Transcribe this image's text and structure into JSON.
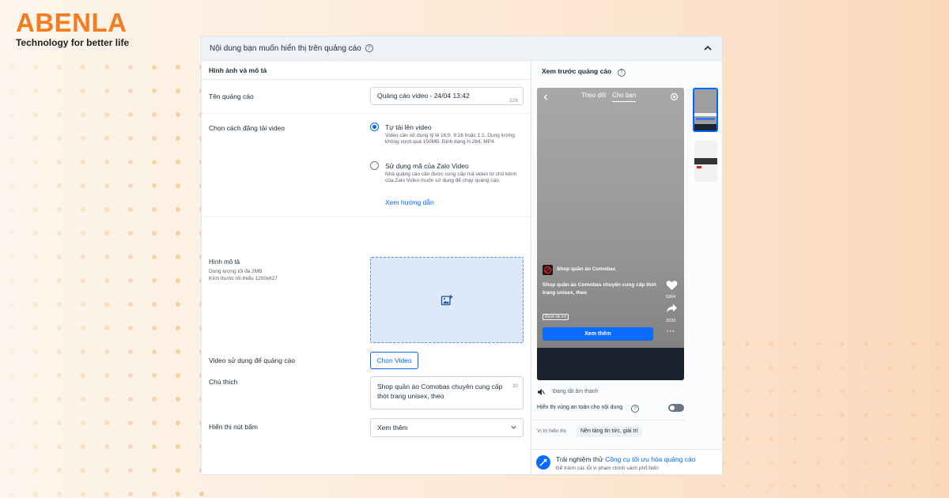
{
  "brand": {
    "name": "ABENLA",
    "tagline": "Technology for better life"
  },
  "panel": {
    "title": "Nội dung bạn muốn hiển thị trên quảng cáo"
  },
  "form": {
    "section_title": "Hình ảnh và mô tả",
    "ad_name": {
      "label": "Tên quảng cáo",
      "value": "Quảng cáo video - 24/04 13:42",
      "counter": "226"
    },
    "upload_method": {
      "label": "Chọn cách đăng tải video",
      "option1": {
        "title": "Tự tải lên video",
        "desc": "Video cần sử dụng tỷ lệ 16:9, 9:16 hoặc 1:1. Dung lượng không vượt quá 150MB. Định dạng H.264, MP4."
      },
      "option2": {
        "title": "Sử dụng mã của Zalo Video",
        "desc": "Nhà quảng cáo cần được cung cấp mã video từ chủ kênh của Zalo Video muốn sử dụng để chạy quảng cáo."
      },
      "guide_link": "Xem hướng dẫn"
    },
    "description_image": {
      "label": "Hình mô tả",
      "sub1": "Dung lượng tối đa 2MB",
      "sub2": "Kích thước tối thiểu 1200x627"
    },
    "video": {
      "label": "Video sử dụng để quảng cáo",
      "button": "Chọn Video"
    },
    "caption": {
      "label": "Chú thích",
      "value": "Shop quần áo Comobas chuyên cung cấp thời trang unisex, theo",
      "counter": "30"
    },
    "cta": {
      "label": "Hiển thị nút bấm",
      "value": "Xem thêm"
    }
  },
  "preview": {
    "title": "Xem trước quảng cáo",
    "tabs": [
      "Theo dõi",
      "Cho bạn"
    ],
    "shop_name": "Shop quần áo Comobas",
    "caption": "Shop quần áo Comobas chuyên cung cấp thời trang unisex, theo",
    "sponsored": "Được tài trợ",
    "likes": "5364",
    "shares": "3333",
    "cta_button": "Xem thêm",
    "sound_status": "Đang tắt âm thanh",
    "safe_zone_label": "Hiển thị vùng an toàn cho nội dung",
    "placement_label": "Vị trí hiển thị:",
    "placement_value": "Nền tảng tin tức, giải trí",
    "tip_prefix": "Trải nghiệm thử ",
    "tip_link": "Công cụ tối ưu hóa quảng cáo",
    "tip_sub": "Để tránh các lỗi vi phạm chính sách phổ biến"
  },
  "colors": {
    "accent": "#0068ff",
    "brand": "#f47c20"
  }
}
